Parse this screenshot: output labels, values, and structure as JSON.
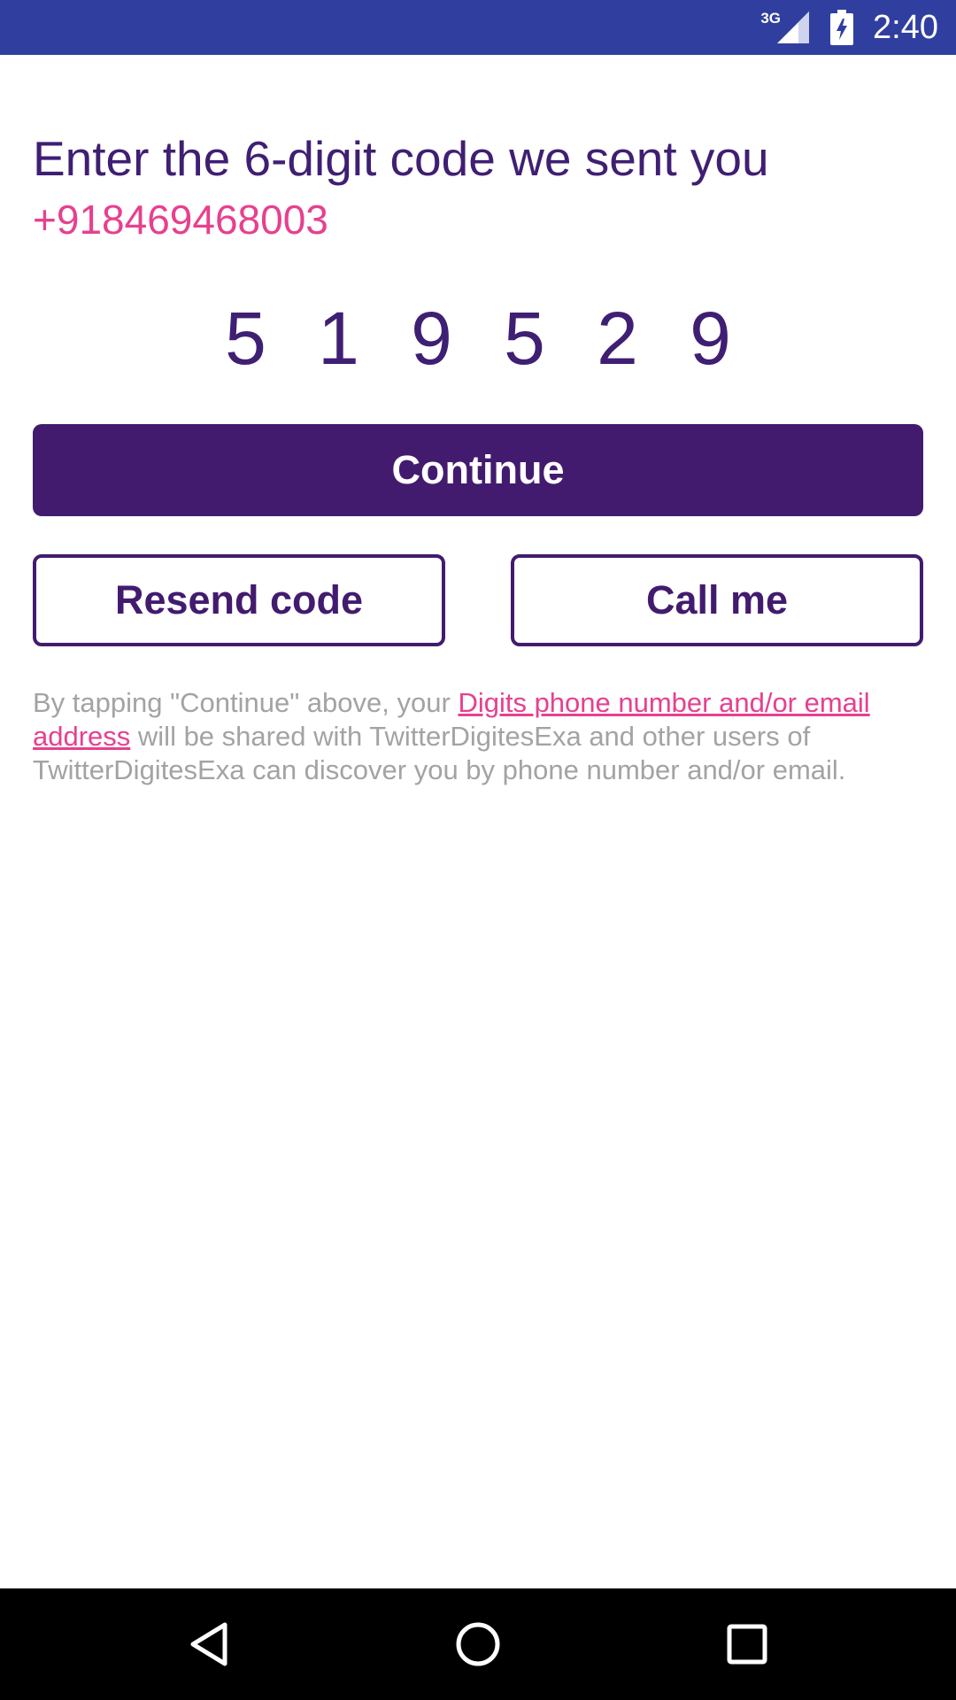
{
  "status_bar": {
    "network": "3G",
    "time": "2:40",
    "icons": [
      "signal-icon",
      "battery-charging-icon"
    ],
    "color": "#303f9f"
  },
  "verify": {
    "headline": "Enter the 6-digit code we sent you",
    "phone_number": "+918469468003",
    "code_digits": [
      "5",
      "1",
      "9",
      "5",
      "2",
      "9"
    ]
  },
  "buttons": {
    "continue_label": "Continue",
    "resend_label": "Resend code",
    "call_label": "Call me"
  },
  "disclaimer": {
    "prefix": "By tapping \"Continue\" above, your ",
    "link_text": "Digits phone number and/or email address",
    "suffix": " will be shared with TwitterDigitesExa and other users of TwitterDigitesExa can discover you by phone number and/or email."
  },
  "nav_bar": {
    "icons": [
      "back-icon",
      "home-icon",
      "recents-icon"
    ]
  },
  "colors": {
    "primary": "#421b6f",
    "accent": "#e7408f",
    "muted_text": "#a3a3a3"
  }
}
